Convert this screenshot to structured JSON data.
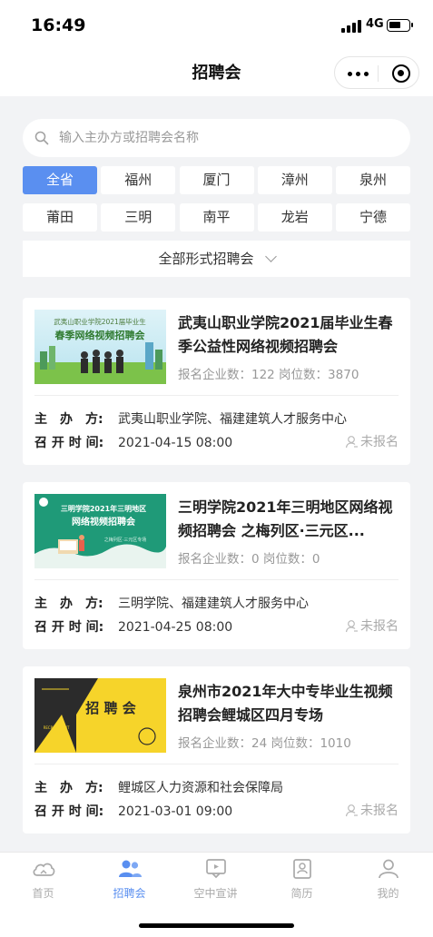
{
  "status_bar": {
    "time": "16:49",
    "network": "4G"
  },
  "navbar": {
    "title": "招聘会"
  },
  "search": {
    "placeholder": "输入主办方或招聘会名称"
  },
  "regions": [
    "全省",
    "福州",
    "厦门",
    "漳州",
    "泉州",
    "莆田",
    "三明",
    "南平",
    "龙岩",
    "宁德"
  ],
  "active_region": "全省",
  "filter": {
    "label": "全部形式招聘会"
  },
  "labels": {
    "host": "主　办　方:",
    "time": "召 开 时 间:",
    "register": "未报名"
  },
  "fairs": [
    {
      "title": "武夷山职业学院2021届毕业生春季公益性网络视频招聘会",
      "stats": "报名企业数：122 岗位数：3870",
      "host": "武夷山职业学院、福建建筑人才服务中心",
      "time": "2021-04-15 08:00",
      "banner": {
        "line1": "武夷山职业学院2021届毕业生",
        "line2": "春季网络视频招聘会"
      }
    },
    {
      "title": "三明学院2021年三明地区网络视频招聘会 之梅列区·三元区...",
      "stats": "报名企业数：0 岗位数：0",
      "host": "三明学院、福建建筑人才服务中心",
      "time": "2021-04-25 08:00",
      "banner": {
        "line1": "三明学院2021年三明地区",
        "line2": "网络视频招聘会",
        "line3": "之梅列区·三元区专场"
      }
    },
    {
      "title": "泉州市2021年大中专毕业生视频招聘会鲤城区四月专场",
      "stats": "报名企业数：24 岗位数：1010",
      "host": "鲤城区人力资源和社会保障局",
      "time": "2021-03-01 09:00",
      "banner": {
        "line1": "招 聘 会",
        "line2": "RECRUITMENT",
        "line3": "FAIR"
      }
    }
  ],
  "tabs": [
    {
      "label": "首页",
      "icon": "home-cloud-icon"
    },
    {
      "label": "招聘会",
      "icon": "people-icon"
    },
    {
      "label": "空中宣讲",
      "icon": "broadcast-icon"
    },
    {
      "label": "简历",
      "icon": "resume-icon"
    },
    {
      "label": "我的",
      "icon": "profile-icon"
    }
  ],
  "active_tab": "招聘会",
  "colors": {
    "accent": "#5a8ff0",
    "background": "#f2f3f5"
  }
}
